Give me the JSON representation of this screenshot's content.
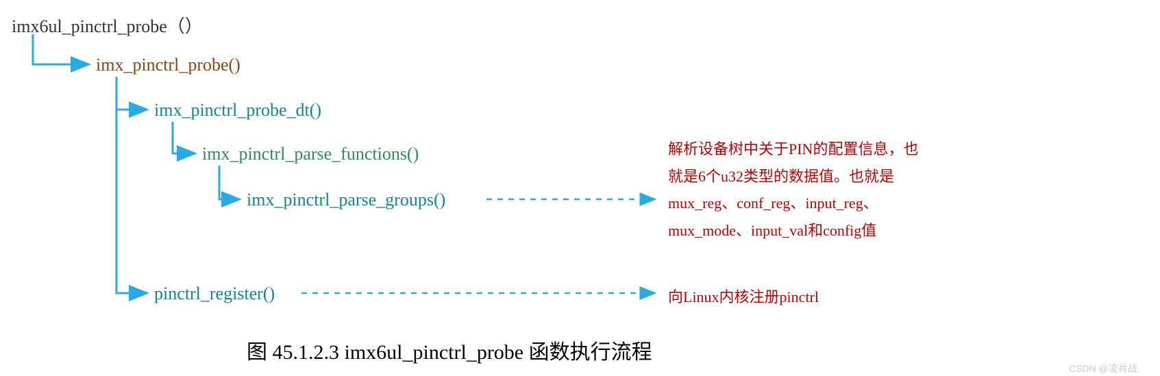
{
  "nodes": {
    "root": "imx6ul_pinctrl_probe（）",
    "level1": "imx_pinctrl_probe()",
    "level2a": "imx_pinctrl_probe_dt()",
    "level3": "imx_pinctrl_parse_functions()",
    "level4": "imx_pinctrl_parse_groups()",
    "level2b": "pinctrl_register()"
  },
  "annotations": {
    "parse_groups": "解析设备树中关于PIN的配置信息，也就是6个u32类型的数据值。也就是mux_reg、conf_reg、input_reg、mux_mode、input_val和config值",
    "register": "向Linux内核注册pinctrl"
  },
  "caption": "图 45.1.2.3 imx6ul_pinctrl_probe 函数执行流程",
  "watermark": "CSDN @凌肖战",
  "colors": {
    "tree_line": "#29ABE2",
    "arrow": "#29ABE2"
  }
}
